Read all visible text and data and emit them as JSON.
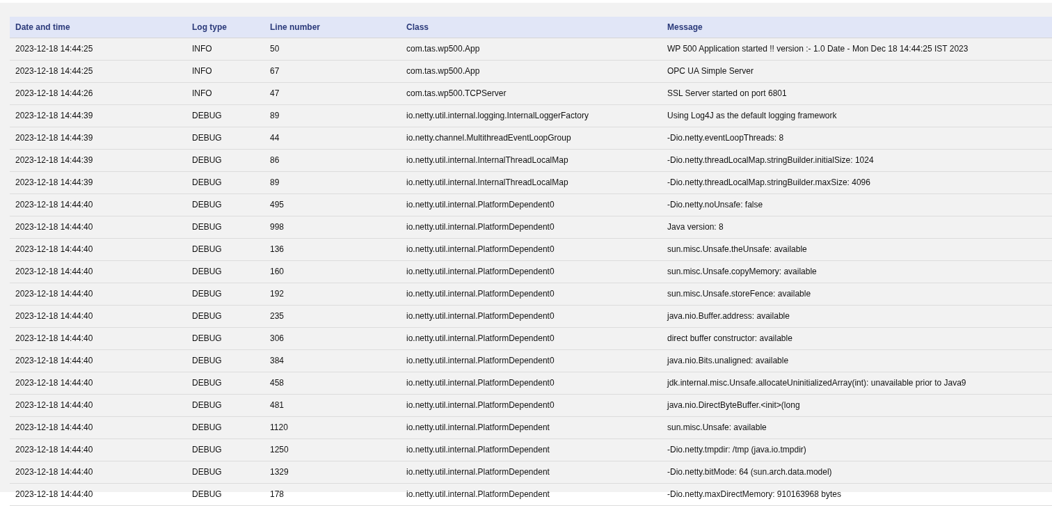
{
  "table": {
    "columns": [
      "Date and time",
      "Log type",
      "Line number",
      "Class",
      "Message"
    ],
    "rows": [
      [
        "2023-12-18 14:44:25",
        "INFO",
        "50",
        "com.tas.wp500.App",
        "WP 500 Application started !! version :- 1.0 Date - Mon Dec 18 14:44:25 IST 2023"
      ],
      [
        "2023-12-18 14:44:25",
        "INFO",
        "67",
        "com.tas.wp500.App",
        "OPC UA Simple Server"
      ],
      [
        "2023-12-18 14:44:26",
        "INFO",
        "47",
        "com.tas.wp500.TCPServer",
        "SSL Server started on port 6801"
      ],
      [
        "2023-12-18 14:44:39",
        "DEBUG",
        "89",
        "io.netty.util.internal.logging.InternalLoggerFactory",
        "Using Log4J as the default logging framework"
      ],
      [
        "2023-12-18 14:44:39",
        "DEBUG",
        "44",
        "io.netty.channel.MultithreadEventLoopGroup",
        "-Dio.netty.eventLoopThreads: 8"
      ],
      [
        "2023-12-18 14:44:39",
        "DEBUG",
        "86",
        "io.netty.util.internal.InternalThreadLocalMap",
        "-Dio.netty.threadLocalMap.stringBuilder.initialSize: 1024"
      ],
      [
        "2023-12-18 14:44:39",
        "DEBUG",
        "89",
        "io.netty.util.internal.InternalThreadLocalMap",
        "-Dio.netty.threadLocalMap.stringBuilder.maxSize: 4096"
      ],
      [
        "2023-12-18 14:44:40",
        "DEBUG",
        "495",
        "io.netty.util.internal.PlatformDependent0",
        "-Dio.netty.noUnsafe: false"
      ],
      [
        "2023-12-18 14:44:40",
        "DEBUG",
        "998",
        "io.netty.util.internal.PlatformDependent0",
        "Java version: 8"
      ],
      [
        "2023-12-18 14:44:40",
        "DEBUG",
        "136",
        "io.netty.util.internal.PlatformDependent0",
        "sun.misc.Unsafe.theUnsafe: available"
      ],
      [
        "2023-12-18 14:44:40",
        "DEBUG",
        "160",
        "io.netty.util.internal.PlatformDependent0",
        "sun.misc.Unsafe.copyMemory: available"
      ],
      [
        "2023-12-18 14:44:40",
        "DEBUG",
        "192",
        "io.netty.util.internal.PlatformDependent0",
        "sun.misc.Unsafe.storeFence: available"
      ],
      [
        "2023-12-18 14:44:40",
        "DEBUG",
        "235",
        "io.netty.util.internal.PlatformDependent0",
        "java.nio.Buffer.address: available"
      ],
      [
        "2023-12-18 14:44:40",
        "DEBUG",
        "306",
        "io.netty.util.internal.PlatformDependent0",
        "direct buffer constructor: available"
      ],
      [
        "2023-12-18 14:44:40",
        "DEBUG",
        "384",
        "io.netty.util.internal.PlatformDependent0",
        "java.nio.Bits.unaligned: available"
      ],
      [
        "2023-12-18 14:44:40",
        "DEBUG",
        "458",
        "io.netty.util.internal.PlatformDependent0",
        "jdk.internal.misc.Unsafe.allocateUninitializedArray(int): unavailable prior to Java9"
      ],
      [
        "2023-12-18 14:44:40",
        "DEBUG",
        "481",
        "io.netty.util.internal.PlatformDependent0",
        "java.nio.DirectByteBuffer.<init>(long"
      ],
      [
        "2023-12-18 14:44:40",
        "DEBUG",
        "1120",
        "io.netty.util.internal.PlatformDependent",
        "sun.misc.Unsafe: available"
      ],
      [
        "2023-12-18 14:44:40",
        "DEBUG",
        "1250",
        "io.netty.util.internal.PlatformDependent",
        "-Dio.netty.tmpdir: /tmp (java.io.tmpdir)"
      ],
      [
        "2023-12-18 14:44:40",
        "DEBUG",
        "1329",
        "io.netty.util.internal.PlatformDependent",
        "-Dio.netty.bitMode: 64 (sun.arch.data.model)"
      ],
      [
        "2023-12-18 14:44:40",
        "DEBUG",
        "178",
        "io.netty.util.internal.PlatformDependent",
        "-Dio.netty.maxDirectMemory: 910163968 bytes"
      ]
    ]
  }
}
